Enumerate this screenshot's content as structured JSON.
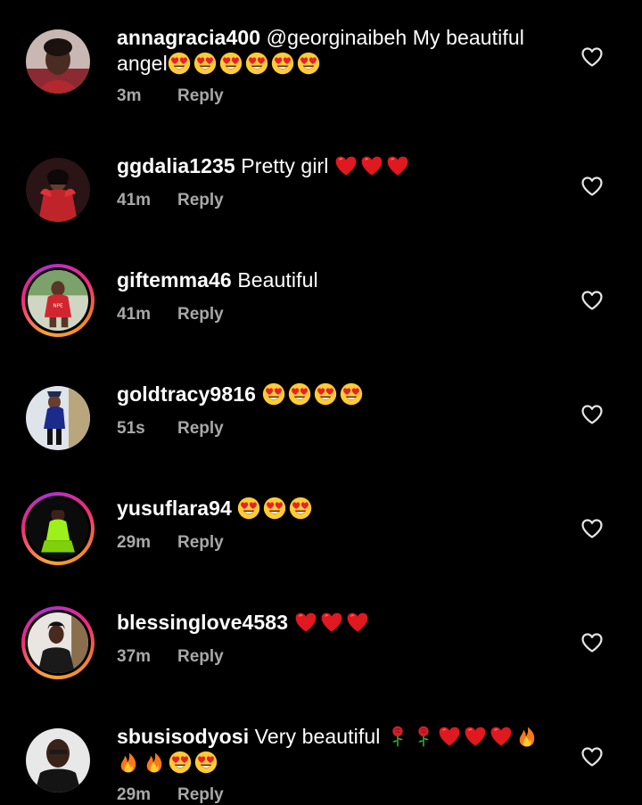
{
  "colors": {
    "background": "#000000",
    "text": "#ffffff",
    "meta": "#a8a8a8"
  },
  "reply_label": "Reply",
  "comments": [
    {
      "username": "annagracia400",
      "text_line1": " @georginaibeh My beautiful",
      "text_line2": "angel",
      "emojis_line2": [
        "smiling-face-with-heart-eyes",
        "smiling-face-with-heart-eyes",
        "smiling-face-with-heart-eyes",
        "smiling-face-with-heart-eyes",
        "smiling-face-with-heart-eyes",
        "smiling-face-with-heart-eyes"
      ],
      "time": "3m",
      "story_ring": false,
      "like_icon": "heart-outline-icon"
    },
    {
      "username": "ggdalia1235",
      "text_line1": " Pretty girl ",
      "emojis_line1": [
        "red-heart",
        "red-heart",
        "red-heart"
      ],
      "time": "41m",
      "story_ring": false,
      "like_icon": "heart-outline-icon"
    },
    {
      "username": "giftemma46",
      "text_line1": " Beautiful",
      "time": "41m",
      "story_ring": true,
      "like_icon": "heart-outline-icon"
    },
    {
      "username": "goldtracy9816",
      "text_line1": " ",
      "emojis_line1": [
        "smiling-face-with-heart-eyes",
        "smiling-face-with-heart-eyes",
        "smiling-face-with-heart-eyes",
        "smiling-face-with-heart-eyes"
      ],
      "time": "51s",
      "story_ring": false,
      "like_icon": "heart-outline-icon"
    },
    {
      "username": "yusuflara94",
      "text_line1": " ",
      "emojis_line1": [
        "smiling-face-with-heart-eyes",
        "smiling-face-with-heart-eyes",
        "smiling-face-with-heart-eyes"
      ],
      "time": "29m",
      "story_ring": true,
      "like_icon": "heart-outline-icon"
    },
    {
      "username": "blessinglove4583",
      "text_line1": " ",
      "emojis_line1": [
        "red-heart",
        "red-heart",
        "red-heart"
      ],
      "time": "37m",
      "story_ring": true,
      "like_icon": "heart-outline-icon"
    },
    {
      "username": "sbusisodyosi",
      "text_line1": " Very beautiful ",
      "emojis_line1": [
        "rose",
        "rose",
        "red-heart",
        "red-heart",
        "red-heart",
        "fire"
      ],
      "emojis_line2": [
        "fire",
        "fire",
        "smiling-face-with-heart-eyes",
        "smiling-face-with-heart-eyes"
      ],
      "time": "29m",
      "story_ring": false,
      "like_icon": "heart-outline-icon"
    }
  ]
}
